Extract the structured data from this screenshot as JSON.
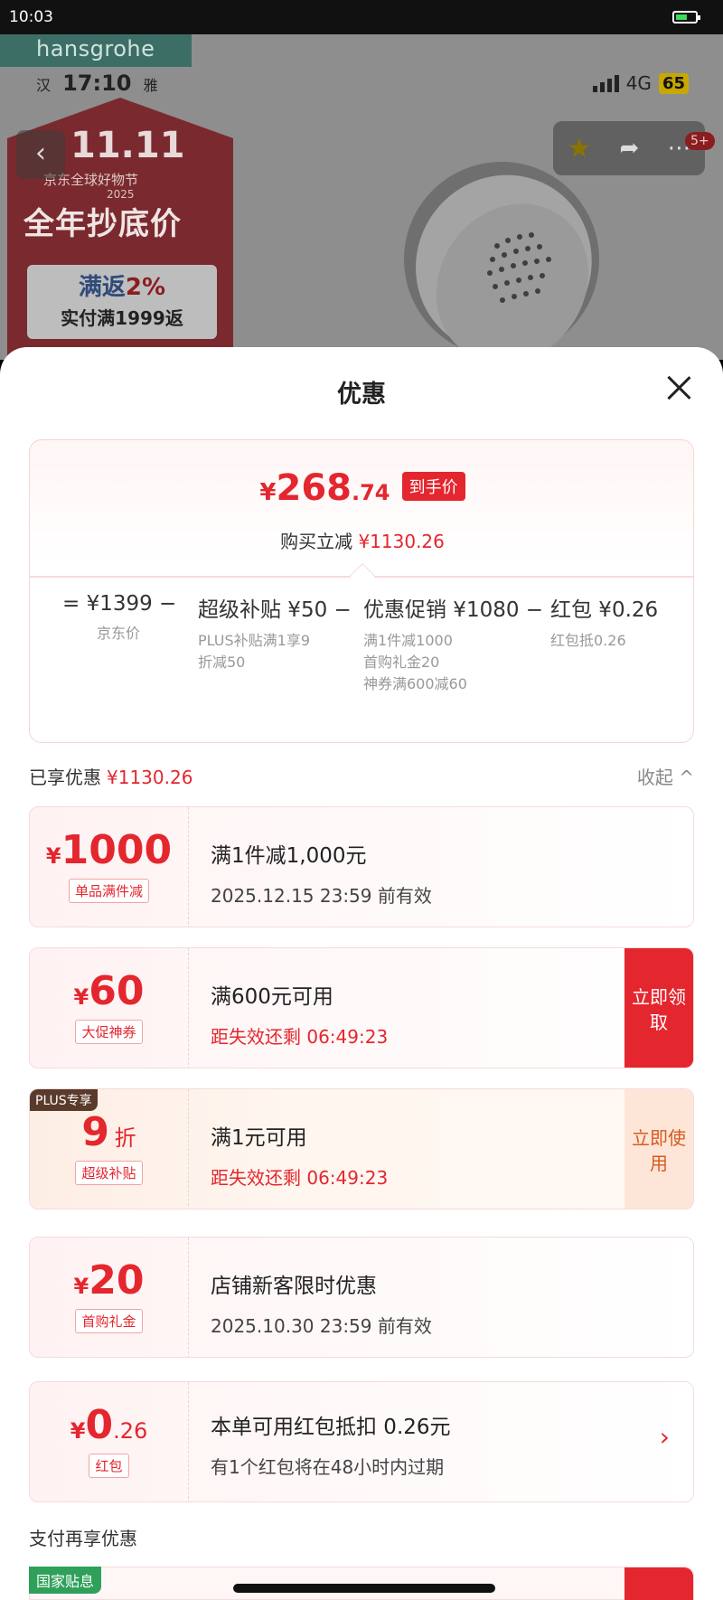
{
  "status_bar": {
    "time": "10:03"
  },
  "backdrop": {
    "brand": "hansgrohe",
    "inner_status": {
      "left_a": "汉",
      "clock": "17:10",
      "left_b": "雅",
      "network": "4G",
      "battery": "65"
    },
    "promo": {
      "big": "11.11",
      "subtitle": "京东全球好物节",
      "year": "2025",
      "title": "全年抄底价",
      "card_line1_prefix": "满返",
      "card_line1_value": "2%",
      "card_line2": "实付满1999返"
    },
    "nav": {
      "badge": "5+"
    }
  },
  "sheet": {
    "title": "优惠",
    "summary": {
      "yen": "¥",
      "price_int": "268",
      "price_dec": ".74",
      "price_tag": "到手价",
      "instant_label": "购买立减",
      "instant_value": "¥1130.26",
      "formula": [
        {
          "value": "= ¥1399 −",
          "notes": [
            "京东价"
          ]
        },
        {
          "value": "超级补贴 ¥50 −",
          "notes": [
            "PLUS补贴满1享9",
            "折减50"
          ]
        },
        {
          "value": "优惠促销 ¥1080 −",
          "notes": [
            "满1件减1000",
            "首购礼金20",
            "神券满600减60"
          ]
        },
        {
          "value": "红包 ¥0.26",
          "notes": [
            "红包抵0.26"
          ]
        }
      ]
    },
    "enjoyed_label": "已享优惠",
    "enjoyed_value": "¥1130.26",
    "collapse_label": "收起 ^",
    "cards": [
      {
        "yen": "¥",
        "amount": "1000",
        "suffix": "",
        "tag": "单品满件减",
        "line1": "满1件减1,000元",
        "line2": "2025.12.15 23:59 前有效"
      },
      {
        "yen": "¥",
        "amount": "60",
        "suffix": "",
        "tag": "大促神券",
        "line1": "满600元可用",
        "line2": "距失效还剩 06:49:23",
        "action": "立即领取"
      },
      {
        "plus_tag": "PLUS专享",
        "yen": "",
        "amount": "9",
        "suffix": "折",
        "tag": "超级补贴",
        "line1": "满1元可用",
        "line2": "距失效还剩 06:49:23",
        "action": "立即使用"
      },
      {
        "yen": "¥",
        "amount": "20",
        "suffix": "",
        "tag": "首购礼金",
        "line1": "店铺新客限时优惠",
        "line2": "2025.10.30 23:59 前有效"
      },
      {
        "yen": "¥",
        "amount": "0",
        "suffix": ".26",
        "tag": "红包",
        "line1": "本单可用红包抵扣 0.26元",
        "line2": "有1个红包将在48小时内过期"
      }
    ],
    "pay_title": "支付再享优惠",
    "gov_tag": "国家贴息"
  }
}
